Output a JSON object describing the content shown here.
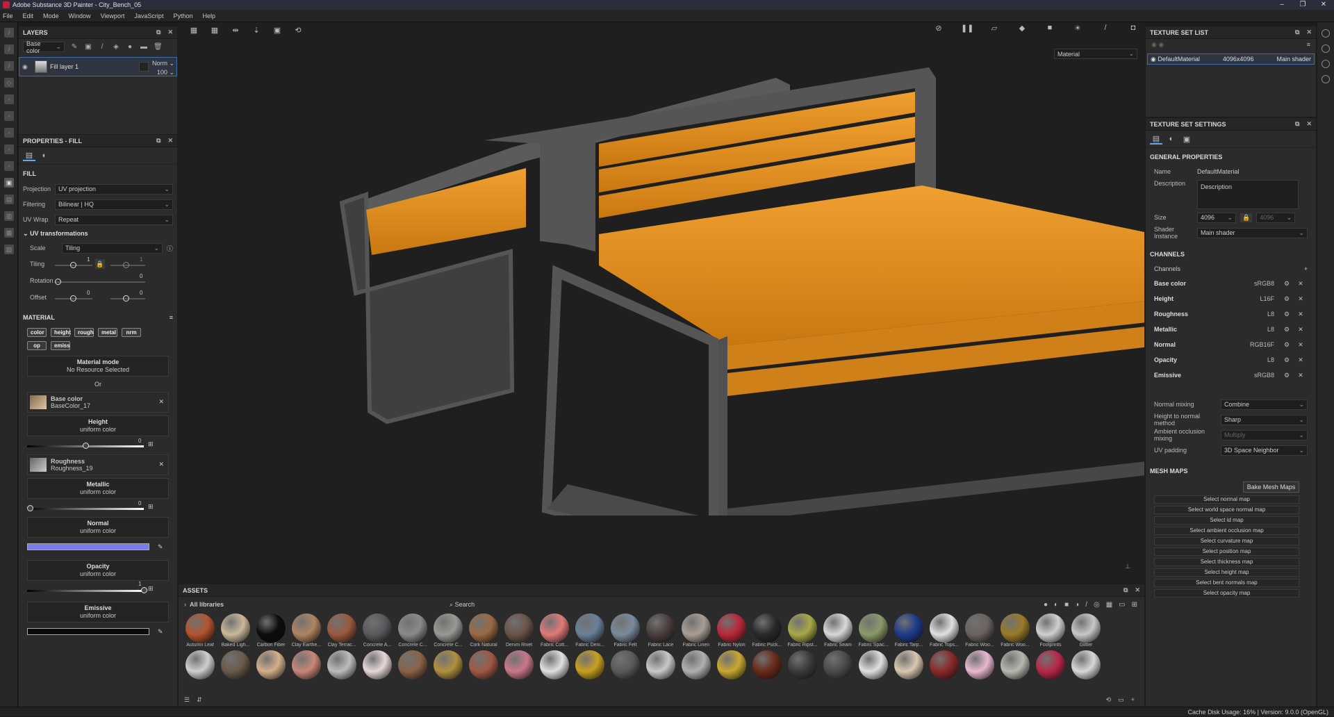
{
  "window": {
    "title": "Adobe Substance 3D Painter - City_Bench_05"
  },
  "menu": [
    "File",
    "Edit",
    "Mode",
    "Window",
    "Viewport",
    "JavaScript",
    "Python",
    "Help"
  ],
  "layers": {
    "title": "LAYERS",
    "channel_select": "Base color",
    "layer_name": "Fill layer 1",
    "blend_mode": "Norm",
    "opacity": "100"
  },
  "props": {
    "title": "PROPERTIES - FILL",
    "fill_label": "FILL",
    "projection_label": "Projection",
    "projection_value": "UV projection",
    "filtering_label": "Filtering",
    "filtering_value": "Bilinear | HQ",
    "uvwrap_label": "UV Wrap",
    "uvwrap_value": "Repeat",
    "uvtrans_label": "UV transformations",
    "scale_label": "Scale",
    "scale_value": "Tiling",
    "tiling_label": "Tiling",
    "tiling_value": "1",
    "tiling_value2": "1",
    "rotation_label": "Rotation",
    "rotation_value": "0",
    "offset_label": "Offset",
    "offset_x": "0",
    "offset_y": "0",
    "material_label": "MATERIAL",
    "chips": [
      "color",
      "height",
      "rough",
      "metal",
      "nrm",
      "op",
      "emiss"
    ],
    "material_mode_title": "Material mode",
    "material_mode_value": "No Resource Selected",
    "or_label": "Or",
    "base_color_title": "Base color",
    "base_color_res": "BaseColor_17",
    "height_title": "Height",
    "height_sub": "uniform color",
    "height_value": "0",
    "rough_title": "Roughness",
    "rough_res": "Roughness_19",
    "metal_title": "Metallic",
    "metal_sub": "uniform color",
    "metal_value": "0",
    "normal_title": "Normal",
    "normal_sub": "uniform color",
    "opacity_title": "Opacity",
    "opacity_sub": "uniform color",
    "opacity_value": "1",
    "emissive_title": "Emissive",
    "emissive_sub": "uniform color"
  },
  "viewport": {
    "material_select": "Material"
  },
  "assets": {
    "title": "ASSETS",
    "library": "All libraries",
    "search_placeholder": "Search",
    "row1": [
      {
        "name": "Autumn Leaf",
        "color": "#b5542c"
      },
      {
        "name": "Baked Ligh...",
        "color": "#c9b89a"
      },
      {
        "name": "Carbon Fiber",
        "color": "#0c0c0c"
      },
      {
        "name": "Clay Earthe...",
        "color": "#b08462"
      },
      {
        "name": "Clay Terrac...",
        "color": "#9a5a3e"
      },
      {
        "name": "Concrete A...",
        "color": "#5a5a5e"
      },
      {
        "name": "Concrete C...",
        "color": "#8a8a88"
      },
      {
        "name": "Concrete C...",
        "color": "#9a9894"
      },
      {
        "name": "Cork Natural",
        "color": "#9a6a44"
      },
      {
        "name": "Denim Rivet",
        "color": "#6a5448"
      },
      {
        "name": "Fabric Cott...",
        "color": "#e07a78"
      },
      {
        "name": "Fabric Deni...",
        "color": "#6a8098"
      },
      {
        "name": "Fabric Felt",
        "color": "#7a8a9c"
      },
      {
        "name": "Fabric Lace",
        "color": "#4a3e3e"
      },
      {
        "name": "Fabric Linen",
        "color": "#a89e96"
      },
      {
        "name": "Fabric Nylon",
        "color": "#b82838"
      },
      {
        "name": "Fabric Puck...",
        "color": "#2a2a2a"
      },
      {
        "name": "Fabric Ripst...",
        "color": "#a8a848"
      },
      {
        "name": "Fabric Seam",
        "color": "#d8d8d8"
      },
      {
        "name": "Fabric Spac...",
        "color": "#8a9a6a"
      },
      {
        "name": "Fabric Tarp...",
        "color": "#1e3a8a"
      },
      {
        "name": "Fabric Tops...",
        "color": "#e0e0e0"
      },
      {
        "name": "Fabric Woo...",
        "color": "#6a6260"
      },
      {
        "name": "Fabric Woo...",
        "color": "#9a7a28"
      },
      {
        "name": "Footprints",
        "color": "#d0d0d0"
      },
      {
        "name": "Glitter",
        "color": "#c8c8c8"
      }
    ],
    "row2": [
      "#cfcfcf",
      "#6a5a4a",
      "#d4b08a",
      "#c88878",
      "#bcbcbc",
      "#e8d8d8",
      "#8a6248",
      "#b09040",
      "#a05844",
      "#c8788a",
      "#e0e0e0",
      "#c8a020",
      "#5a5a5a",
      "#c8c8c8",
      "#b0b0b0",
      "#c8a830",
      "#6a2a1a",
      "#3a3a3a",
      "#4a4a4a",
      "#e0e0e0",
      "#d8c8b0",
      "#8a2a28",
      "#e8b8d0",
      "#b8b8b0",
      "#b82848",
      "#d8d8d8"
    ]
  },
  "tsl": {
    "title": "TEXTURE SET LIST",
    "set_name": "DefaultMaterial",
    "set_size": "4096x4096",
    "set_shader": "Main shader"
  },
  "tss": {
    "title": "TEXTURE SET SETTINGS",
    "general_label": "GENERAL PROPERTIES",
    "name_label": "Name",
    "name_value": "DefaultMaterial",
    "desc_label": "Description",
    "desc_value": "Description",
    "size_label": "Size",
    "size_value": "4096",
    "size_value2": "4096",
    "shader_label": "Shader Instance",
    "shader_value": "Main shader",
    "channels_label": "CHANNELS",
    "channels_sub": "Channels",
    "channels": [
      {
        "name": "Base color",
        "fmt": "sRGB8"
      },
      {
        "name": "Height",
        "fmt": "L16F"
      },
      {
        "name": "Roughness",
        "fmt": "L8"
      },
      {
        "name": "Metallic",
        "fmt": "L8"
      },
      {
        "name": "Normal",
        "fmt": "RGB16F"
      },
      {
        "name": "Opacity",
        "fmt": "L8"
      },
      {
        "name": "Emissive",
        "fmt": "sRGB8"
      }
    ],
    "normal_mixing_label": "Normal mixing",
    "normal_mixing_value": "Combine",
    "h2n_label": "Height to normal method",
    "h2n_value": "Sharp",
    "ao_label": "Ambient occlusion mixing",
    "ao_value": "Multiply",
    "uvpad_label": "UV padding",
    "uvpad_value": "3D Space Neighbor",
    "mesh_maps_label": "MESH MAPS",
    "bake_label": "Bake Mesh Maps",
    "maps": [
      "Select normal map",
      "Select world space normal map",
      "Select id map",
      "Select ambient occlusion map",
      "Select curvature map",
      "Select position map",
      "Select thickness map",
      "Select height map",
      "Select bent normals map",
      "Select opacity map"
    ]
  },
  "status": {
    "text": "Cache Disk Usage:   16% | Version: 9.0.0 (OpenGL)"
  }
}
